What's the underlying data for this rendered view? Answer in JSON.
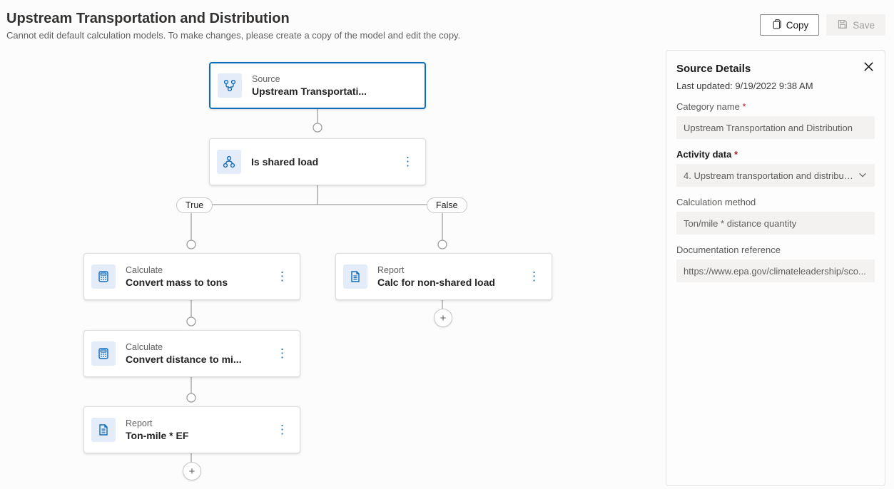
{
  "header": {
    "title": "Upstream Transportation and Distribution",
    "subtitle": "Cannot edit default calculation models. To make changes, please create a copy of the model and edit the copy.",
    "copy_label": "Copy",
    "save_label": "Save"
  },
  "flow": {
    "source": {
      "label": "Source",
      "title": "Upstream Transportati..."
    },
    "condition": {
      "title": "Is shared load"
    },
    "truePill": "True",
    "falsePill": "False",
    "trueBranch": [
      {
        "label": "Calculate",
        "title": "Convert mass to tons",
        "icon": "calc"
      },
      {
        "label": "Calculate",
        "title": "Convert distance to mi...",
        "icon": "calc"
      },
      {
        "label": "Report",
        "title": "Ton-mile * EF",
        "icon": "report"
      }
    ],
    "falseBranch": [
      {
        "label": "Report",
        "title": "Calc for non-shared load",
        "icon": "report"
      }
    ]
  },
  "panel": {
    "title": "Source Details",
    "updated_prefix": "Last updated: ",
    "updated_value": "9/19/2022 9:38 AM",
    "f_category_label": "Category name",
    "f_category_value": "Upstream Transportation and Distribution",
    "f_activity_label": "Activity data",
    "f_activity_value": "4. Upstream transportation and distributio",
    "f_method_label": "Calculation method",
    "f_method_value": "Ton/mile * distance quantity",
    "f_doc_label": "Documentation reference",
    "f_doc_value": "https://www.epa.gov/climateleadership/sco..."
  }
}
